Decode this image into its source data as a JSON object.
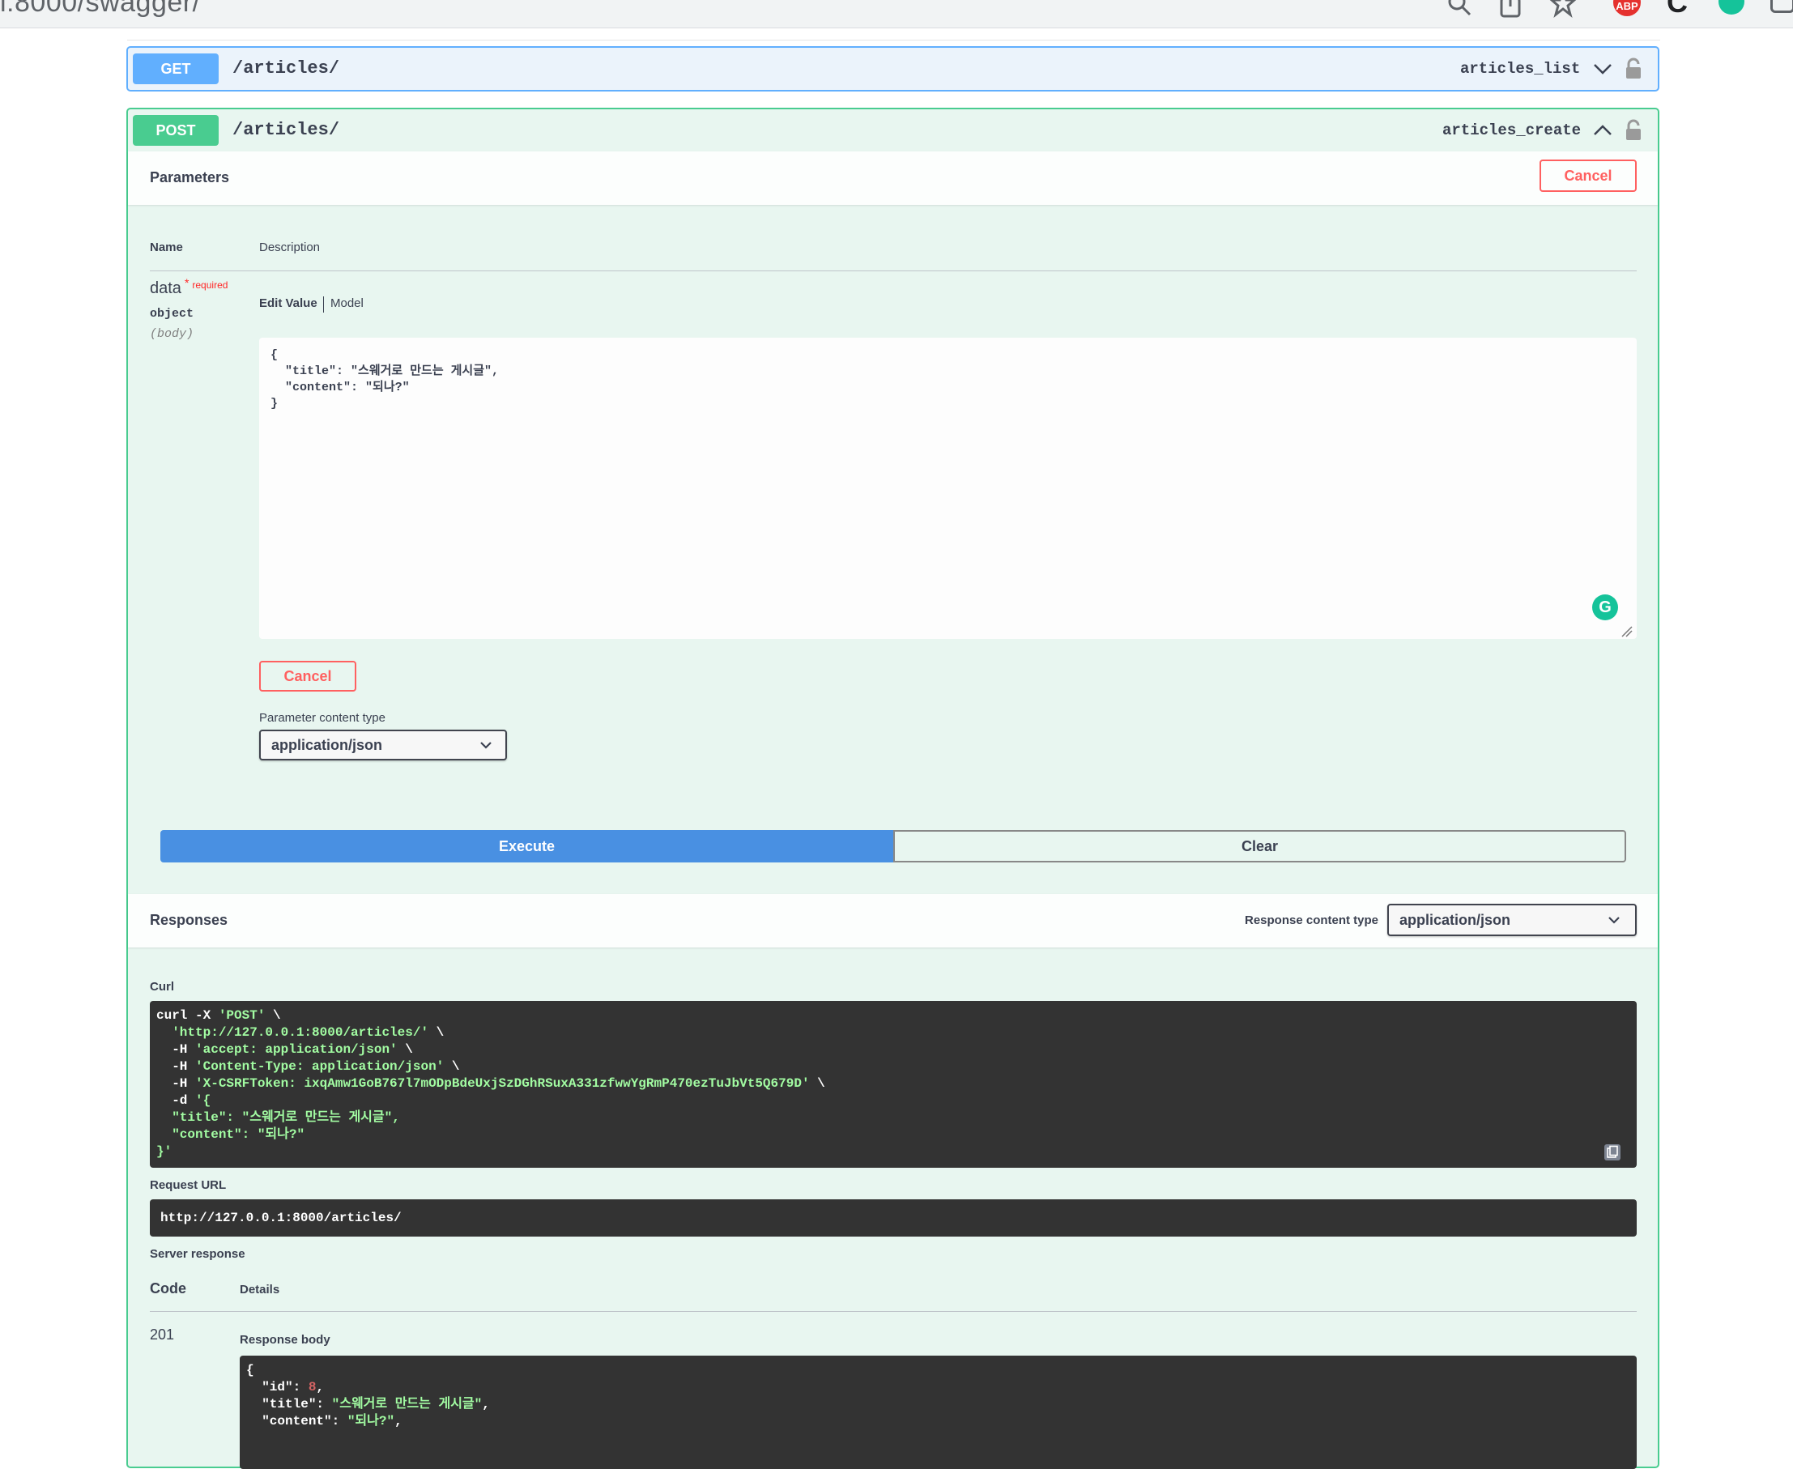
{
  "browser": {
    "url_fragment": "l:8000/swagger/"
  },
  "ops": {
    "get": {
      "method": "GET",
      "path": "/articles/",
      "operation_id": "articles_list"
    },
    "post": {
      "method": "POST",
      "path": "/articles/",
      "operation_id": "articles_create"
    }
  },
  "parameters": {
    "title": "Parameters",
    "cancel_label": "Cancel",
    "col_name": "Name",
    "col_description": "Description",
    "param": {
      "name": "data",
      "star": "*",
      "required_label": "required",
      "type": "object",
      "location": "(body)"
    },
    "tabs": {
      "edit_value": "Edit Value",
      "model": "Model"
    },
    "body_value": "{\n  \"title\": \"스웨거로 만드는 게시글\",\n  \"content\": \"되나?\"\n}",
    "cancel_inline_label": "Cancel",
    "content_type_label": "Parameter content type",
    "content_type_value": "application/json"
  },
  "actions": {
    "execute": "Execute",
    "clear": "Clear"
  },
  "responses": {
    "title": "Responses",
    "content_type_label": "Response content type",
    "content_type_value": "application/json",
    "curl_label": "Curl",
    "curl": {
      "l1_a": "curl -X ",
      "l1_b": "'POST'",
      "l1_c": " \\",
      "l2_a": "  ",
      "l2_b": "'http://127.0.0.1:8000/articles/'",
      "l2_c": " \\",
      "l3_a": "  -H ",
      "l3_b": "'accept: application/json'",
      "l3_c": " \\",
      "l4_a": "  -H ",
      "l4_b": "'Content-Type: application/json'",
      "l4_c": " \\",
      "l5_a": "  -H ",
      "l5_b": "'X-CSRFToken: ixqAmw1GoB767l7mODpBdeUxjSzDGhRSuxA331zfwwYgRmP470ezTuJbVt5Q679D'",
      "l5_c": " \\",
      "l6_a": "  -d ",
      "l6_b": "'{",
      "l7": "  \"title\": \"스웨거로 만드는 게시글\",",
      "l8": "  \"content\": \"되나?\"",
      "l9": "}'"
    },
    "request_url_label": "Request URL",
    "request_url": "http://127.0.0.1:8000/articles/",
    "server_response_label": "Server response",
    "col_code": "Code",
    "col_details": "Details",
    "code": "201",
    "response_body_label": "Response body",
    "body": {
      "open": "{",
      "id_key": "  \"id\": ",
      "id_val": "8",
      "title_key": "  \"title\": ",
      "title_val": "\"스웨거로 만드는 게시글\"",
      "content_key": "  \"content\": ",
      "content_val": "\"되나?\""
    }
  },
  "colors": {
    "get": "#61affe",
    "post": "#49cc90",
    "execute": "#4990e2",
    "cancel": "#ff6060"
  },
  "icons": [
    "search-icon",
    "share-icon",
    "bookmark-star-icon",
    "adblock-icon",
    "extension-c-icon",
    "grammarly-icon",
    "chevron-down-icon",
    "chevron-up-icon",
    "lock-icon",
    "copy-icon"
  ]
}
